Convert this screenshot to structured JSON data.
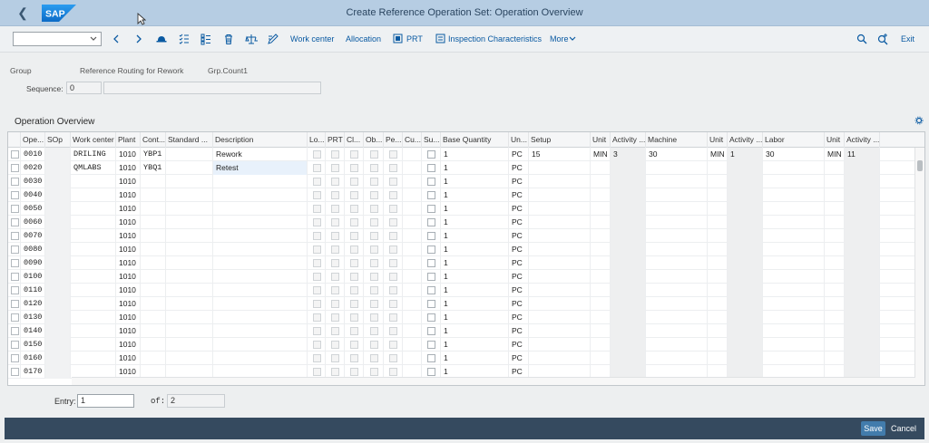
{
  "shell": {
    "title": "Create Reference Operation Set: Operation Overview",
    "logo_text": "SAP"
  },
  "toolbar": {
    "select_value": "",
    "work_center": "Work center",
    "allocation": "Allocation",
    "prt": "PRT",
    "inspection": "Inspection Characteristics",
    "more": "More",
    "exit": "Exit"
  },
  "header": {
    "group_label": "Group",
    "group_desc": "Reference Routing for Rework",
    "grp_count_label": "Grp.Count1",
    "sequence_label": "Sequence:",
    "sequence_value": "0",
    "sequence_desc": ""
  },
  "section": {
    "title": "Operation Overview"
  },
  "table": {
    "columns": {
      "ope": "Ope...",
      "sop": "SOp",
      "work_center": "Work center",
      "plant": "Plant",
      "cont": "Cont...",
      "standard": "Standard ...",
      "description": "Description",
      "lo": "Lo...",
      "prt": "PRT",
      "cl": "Cl...",
      "ob": "Ob...",
      "pe": "Pe...",
      "cu": "Cu...",
      "su": "Su...",
      "base_qty": "Base Quantity",
      "un": "Un...",
      "setup": "Setup",
      "unit1": "Unit",
      "activity1": "Activity ...",
      "machine": "Machine",
      "unit2": "Unit",
      "activity2": "Activity ...",
      "labor": "Labor",
      "unit3": "Unit",
      "activity3": "Activity ..."
    },
    "rows": [
      {
        "op": "0010",
        "wc": "DRILING",
        "plant": "1010",
        "cont": "YBP1",
        "desc": "Rework",
        "qty": "1",
        "un": "PC",
        "setup": "15",
        "u1": "MIN",
        "a1": "3",
        "machine": "30",
        "u2": "MIN",
        "a2": "1",
        "labor": "30",
        "u3": "MIN",
        "a3": "11"
      },
      {
        "op": "0020",
        "wc": "QMLABS",
        "plant": "1010",
        "cont": "YBQ1",
        "desc": "Retest",
        "qty": "1",
        "un": "PC",
        "setup": "",
        "u1": "",
        "a1": "",
        "machine": "",
        "u2": "",
        "a2": "",
        "labor": "",
        "u3": "",
        "a3": ""
      },
      {
        "op": "0030",
        "wc": "",
        "plant": "1010",
        "cont": "",
        "desc": "",
        "qty": "1",
        "un": "PC",
        "setup": "",
        "u1": "",
        "a1": "",
        "machine": "",
        "u2": "",
        "a2": "",
        "labor": "",
        "u3": "",
        "a3": ""
      },
      {
        "op": "0040",
        "wc": "",
        "plant": "1010",
        "cont": "",
        "desc": "",
        "qty": "1",
        "un": "PC",
        "setup": "",
        "u1": "",
        "a1": "",
        "machine": "",
        "u2": "",
        "a2": "",
        "labor": "",
        "u3": "",
        "a3": ""
      },
      {
        "op": "0050",
        "wc": "",
        "plant": "1010",
        "cont": "",
        "desc": "",
        "qty": "1",
        "un": "PC",
        "setup": "",
        "u1": "",
        "a1": "",
        "machine": "",
        "u2": "",
        "a2": "",
        "labor": "",
        "u3": "",
        "a3": ""
      },
      {
        "op": "0060",
        "wc": "",
        "plant": "1010",
        "cont": "",
        "desc": "",
        "qty": "1",
        "un": "PC",
        "setup": "",
        "u1": "",
        "a1": "",
        "machine": "",
        "u2": "",
        "a2": "",
        "labor": "",
        "u3": "",
        "a3": ""
      },
      {
        "op": "0070",
        "wc": "",
        "plant": "1010",
        "cont": "",
        "desc": "",
        "qty": "1",
        "un": "PC",
        "setup": "",
        "u1": "",
        "a1": "",
        "machine": "",
        "u2": "",
        "a2": "",
        "labor": "",
        "u3": "",
        "a3": ""
      },
      {
        "op": "0080",
        "wc": "",
        "plant": "1010",
        "cont": "",
        "desc": "",
        "qty": "1",
        "un": "PC",
        "setup": "",
        "u1": "",
        "a1": "",
        "machine": "",
        "u2": "",
        "a2": "",
        "labor": "",
        "u3": "",
        "a3": ""
      },
      {
        "op": "0090",
        "wc": "",
        "plant": "1010",
        "cont": "",
        "desc": "",
        "qty": "1",
        "un": "PC",
        "setup": "",
        "u1": "",
        "a1": "",
        "machine": "",
        "u2": "",
        "a2": "",
        "labor": "",
        "u3": "",
        "a3": ""
      },
      {
        "op": "0100",
        "wc": "",
        "plant": "1010",
        "cont": "",
        "desc": "",
        "qty": "1",
        "un": "PC",
        "setup": "",
        "u1": "",
        "a1": "",
        "machine": "",
        "u2": "",
        "a2": "",
        "labor": "",
        "u3": "",
        "a3": ""
      },
      {
        "op": "0110",
        "wc": "",
        "plant": "1010",
        "cont": "",
        "desc": "",
        "qty": "1",
        "un": "PC",
        "setup": "",
        "u1": "",
        "a1": "",
        "machine": "",
        "u2": "",
        "a2": "",
        "labor": "",
        "u3": "",
        "a3": ""
      },
      {
        "op": "0120",
        "wc": "",
        "plant": "1010",
        "cont": "",
        "desc": "",
        "qty": "1",
        "un": "PC",
        "setup": "",
        "u1": "",
        "a1": "",
        "machine": "",
        "u2": "",
        "a2": "",
        "labor": "",
        "u3": "",
        "a3": ""
      },
      {
        "op": "0130",
        "wc": "",
        "plant": "1010",
        "cont": "",
        "desc": "",
        "qty": "1",
        "un": "PC",
        "setup": "",
        "u1": "",
        "a1": "",
        "machine": "",
        "u2": "",
        "a2": "",
        "labor": "",
        "u3": "",
        "a3": ""
      },
      {
        "op": "0140",
        "wc": "",
        "plant": "1010",
        "cont": "",
        "desc": "",
        "qty": "1",
        "un": "PC",
        "setup": "",
        "u1": "",
        "a1": "",
        "machine": "",
        "u2": "",
        "a2": "",
        "labor": "",
        "u3": "",
        "a3": ""
      },
      {
        "op": "0150",
        "wc": "",
        "plant": "1010",
        "cont": "",
        "desc": "",
        "qty": "1",
        "un": "PC",
        "setup": "",
        "u1": "",
        "a1": "",
        "machine": "",
        "u2": "",
        "a2": "",
        "labor": "",
        "u3": "",
        "a3": ""
      },
      {
        "op": "0160",
        "wc": "",
        "plant": "1010",
        "cont": "",
        "desc": "",
        "qty": "1",
        "un": "PC",
        "setup": "",
        "u1": "",
        "a1": "",
        "machine": "",
        "u2": "",
        "a2": "",
        "labor": "",
        "u3": "",
        "a3": ""
      },
      {
        "op": "0170",
        "wc": "",
        "plant": "1010",
        "cont": "",
        "desc": "",
        "qty": "1",
        "un": "PC",
        "setup": "",
        "u1": "",
        "a1": "",
        "machine": "",
        "u2": "",
        "a2": "",
        "labor": "",
        "u3": "",
        "a3": ""
      }
    ]
  },
  "footer": {
    "entry_label": "Entry:",
    "entry_value": "1",
    "of_label": "of:",
    "of_value": "2"
  },
  "bottom": {
    "save": "Save",
    "cancel": "Cancel"
  },
  "colors": {
    "shell": "#b6cde3",
    "link": "#0a5aa2",
    "bottombar": "#354a5f",
    "save": "#427cac"
  }
}
